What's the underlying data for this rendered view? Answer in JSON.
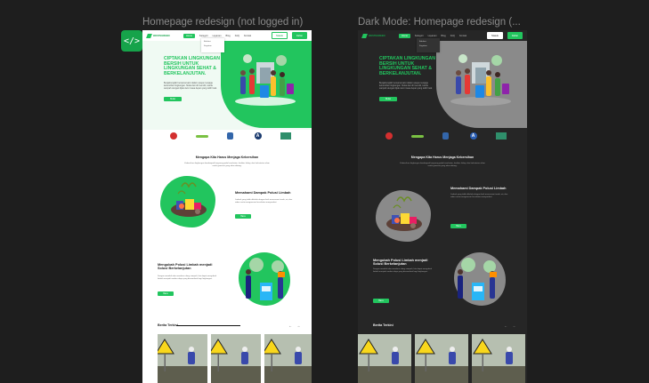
{
  "canvas": {
    "light_frame_label": "Homepage redesign (not logged in)",
    "dark_frame_label": "Dark Mode: Homepage redesign (...",
    "dev_badge": "</>"
  },
  "nav": {
    "logo": "WASTEGREEN",
    "items": [
      "Home",
      "Kategori",
      "Layanan",
      "Blog",
      "FAQ",
      "Kontak"
    ],
    "active": "Home",
    "login": "Masuk",
    "register": "Daftar",
    "dropdown": [
      "Edukasi",
      "Kegiatan"
    ]
  },
  "hero": {
    "title": "CIPTAKAN LINGKUNGAN BERSIH UNTUK LINGKUNGAN SEHAT & BERKELANJUTAN.",
    "description": "Bergabunglah bersama kami dalam upaya menjaga kebersihan lingkungan. Mulai dari diri sendiri, kelola sampah dengan bijak demi masa depan yang lebih baik.",
    "button": "Mulai"
  },
  "partners": [
    "Pertamina",
    "Greenpeace",
    "KLHK",
    "A",
    "WWF"
  ],
  "why": {
    "title": "Mengapa Kita Harus Menjaga Kebersihan",
    "description": "Kebersihan lingkungan berdampak langsung pada kesehatan, kualitas hidup, dan kelestarian alam untuk generasi yang akan datang."
  },
  "feature1": {
    "title": "Memahami Dampak Polusi Limbah",
    "description": "Limbah yang tidak dikelola dengan baik mencemari tanah, air, dan udara serta mengancam kesehatan masyarakat.",
    "button": "Baca"
  },
  "feature2": {
    "title": "Mengubah Polusi Limbah menjadi Solusi Berkelanjutan",
    "description": "Dengan memilah dan mendaur ulang sampah, kita dapat mengubah limbah menjadi sumber daya yang bermanfaat bagi lingkungan.",
    "button": "Baca"
  },
  "news": {
    "title": "Berita Terkini",
    "arrows": "← →"
  },
  "colors": {
    "accent": "#22c55e",
    "dark_bg": "#262626",
    "canvas_bg": "#1e1e1e"
  }
}
